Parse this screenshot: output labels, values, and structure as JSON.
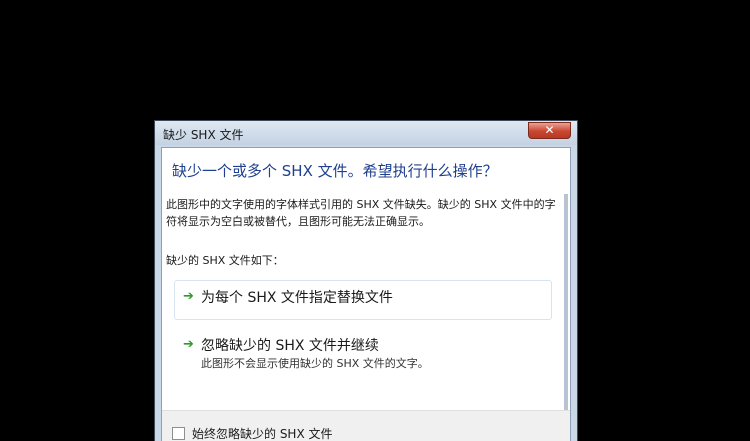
{
  "window": {
    "title": "缺少 SHX 文件",
    "close_label": "✕"
  },
  "dialog": {
    "main_instruction": "缺少一个或多个 SHX 文件。希望执行什么操作？",
    "content": "此图形中的文字使用的字体样式引用的 SHX 文件缺失。缺少的 SHX 文件中的字符将显示为空白或被替代，且图形可能无法正确显示。",
    "list_caption": "缺少的 SHX 文件如下："
  },
  "commands": [
    {
      "icon": "green-arrow-icon",
      "label": "为每个 SHX 文件指定替换文件",
      "note": ""
    },
    {
      "icon": "green-arrow-icon",
      "label": "忽略缺少的 SHX 文件并继续",
      "note": "此图形不会显示使用缺少的 SHX 文件的文字。"
    }
  ],
  "footer": {
    "checkbox_label": "始终忽略缺少的 SHX 文件",
    "checked": false
  },
  "colors": {
    "instruction_blue": "#1f3f8f",
    "arrow_green": "#2f9a2f",
    "close_red": "#c9462f"
  }
}
